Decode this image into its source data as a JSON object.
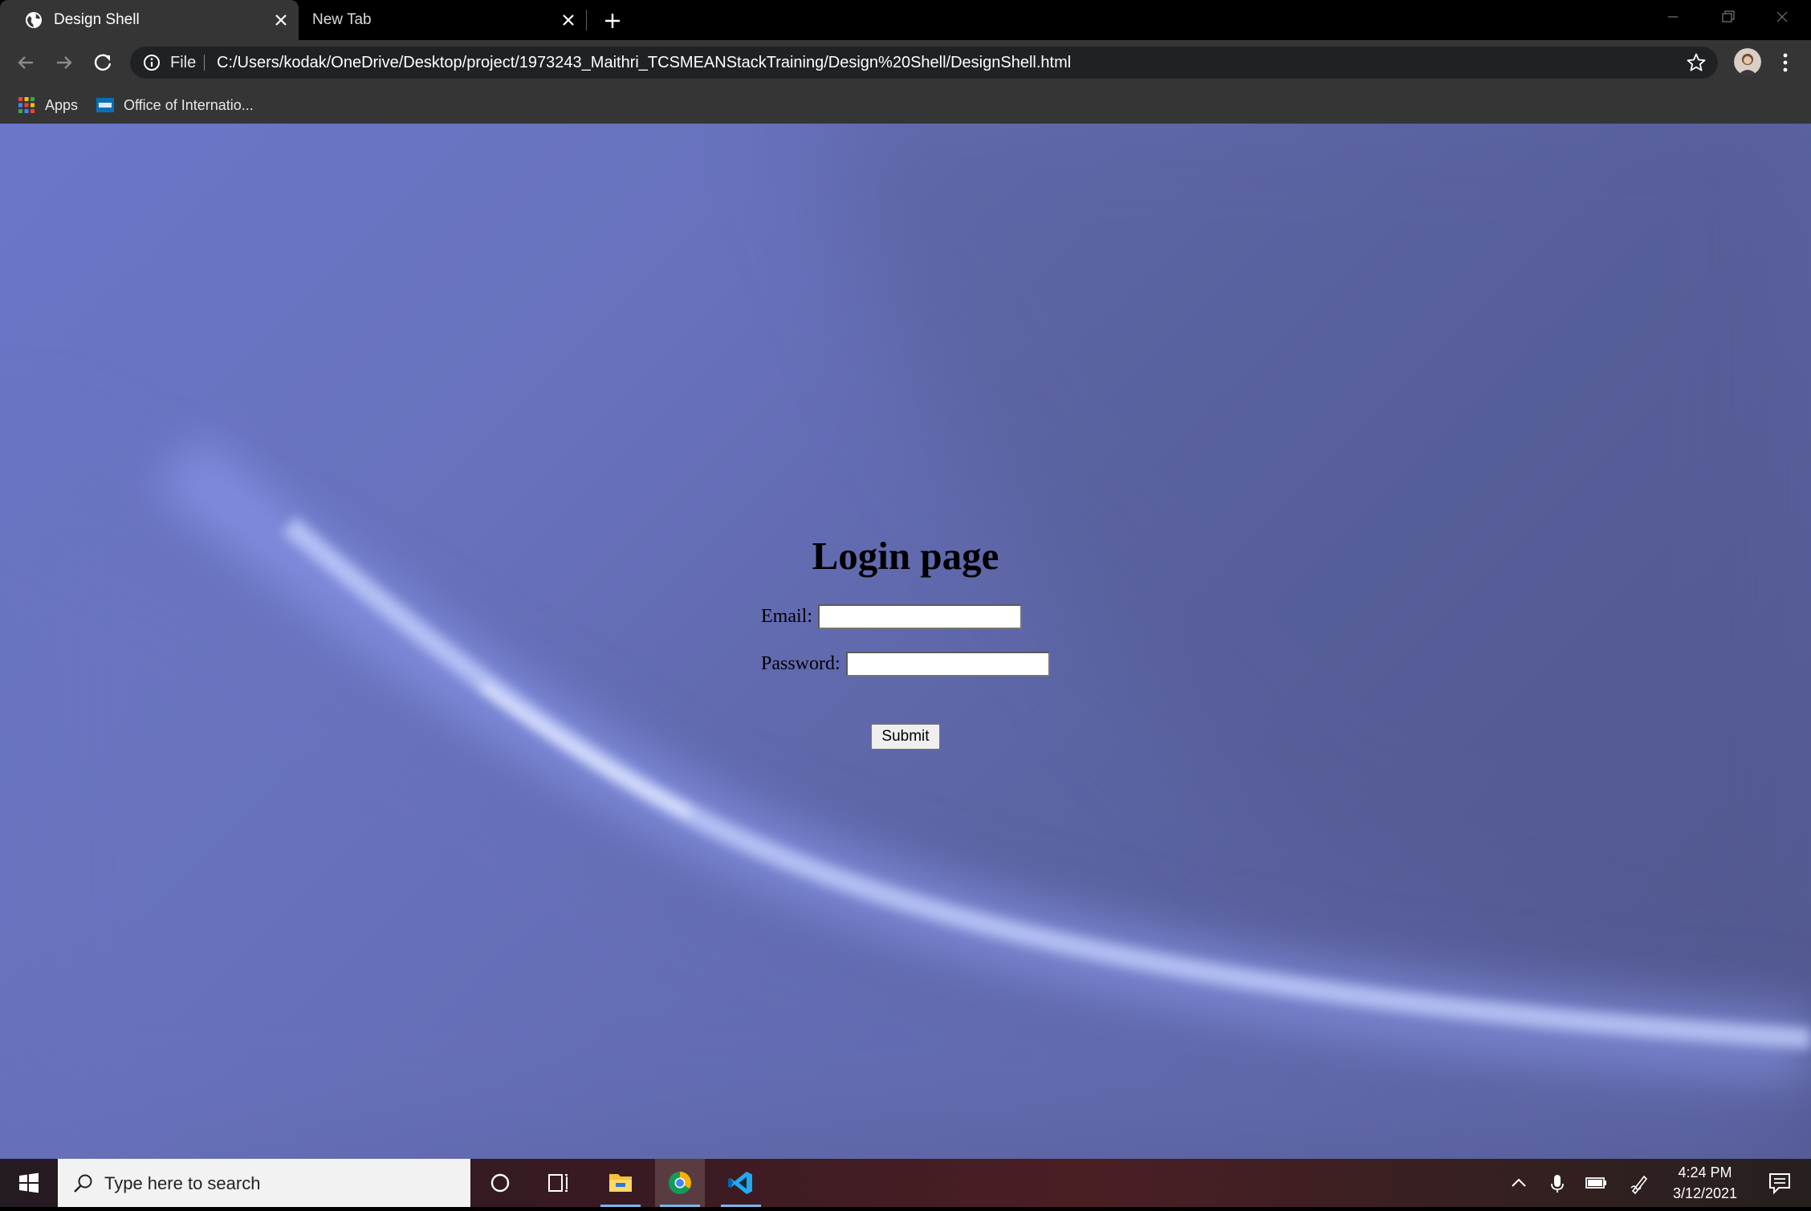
{
  "browser": {
    "tabs": [
      {
        "title": "Design Shell",
        "active": true
      },
      {
        "title": "New Tab",
        "active": false
      }
    ],
    "address_bar": {
      "scheme_label": "File",
      "url": "C:/Users/kodak/OneDrive/Desktop/project/1973243_Maithri_TCSMEANStackTraining/Design%20Shell/DesignShell.html"
    },
    "bookmarks": [
      {
        "label": "Apps",
        "icon": "apps-grid-icon"
      },
      {
        "label": "Office of Internatio...",
        "icon": "uhcl-favicon"
      }
    ]
  },
  "page": {
    "title": "Login page",
    "fields": [
      {
        "label": "Email:",
        "value": ""
      },
      {
        "label": "Password:",
        "value": ""
      }
    ],
    "submit_label": "Submit",
    "background_colors": [
      "#6a76c8",
      "#9fb0ff",
      "#535890"
    ]
  },
  "taskbar": {
    "search_placeholder": "Type here to search",
    "apps": [
      "cortana-icon",
      "task-view-icon",
      "file-explorer-icon",
      "chrome-icon",
      "vscode-icon"
    ],
    "clock": {
      "time": "4:24 PM",
      "date": "3/12/2021"
    }
  }
}
